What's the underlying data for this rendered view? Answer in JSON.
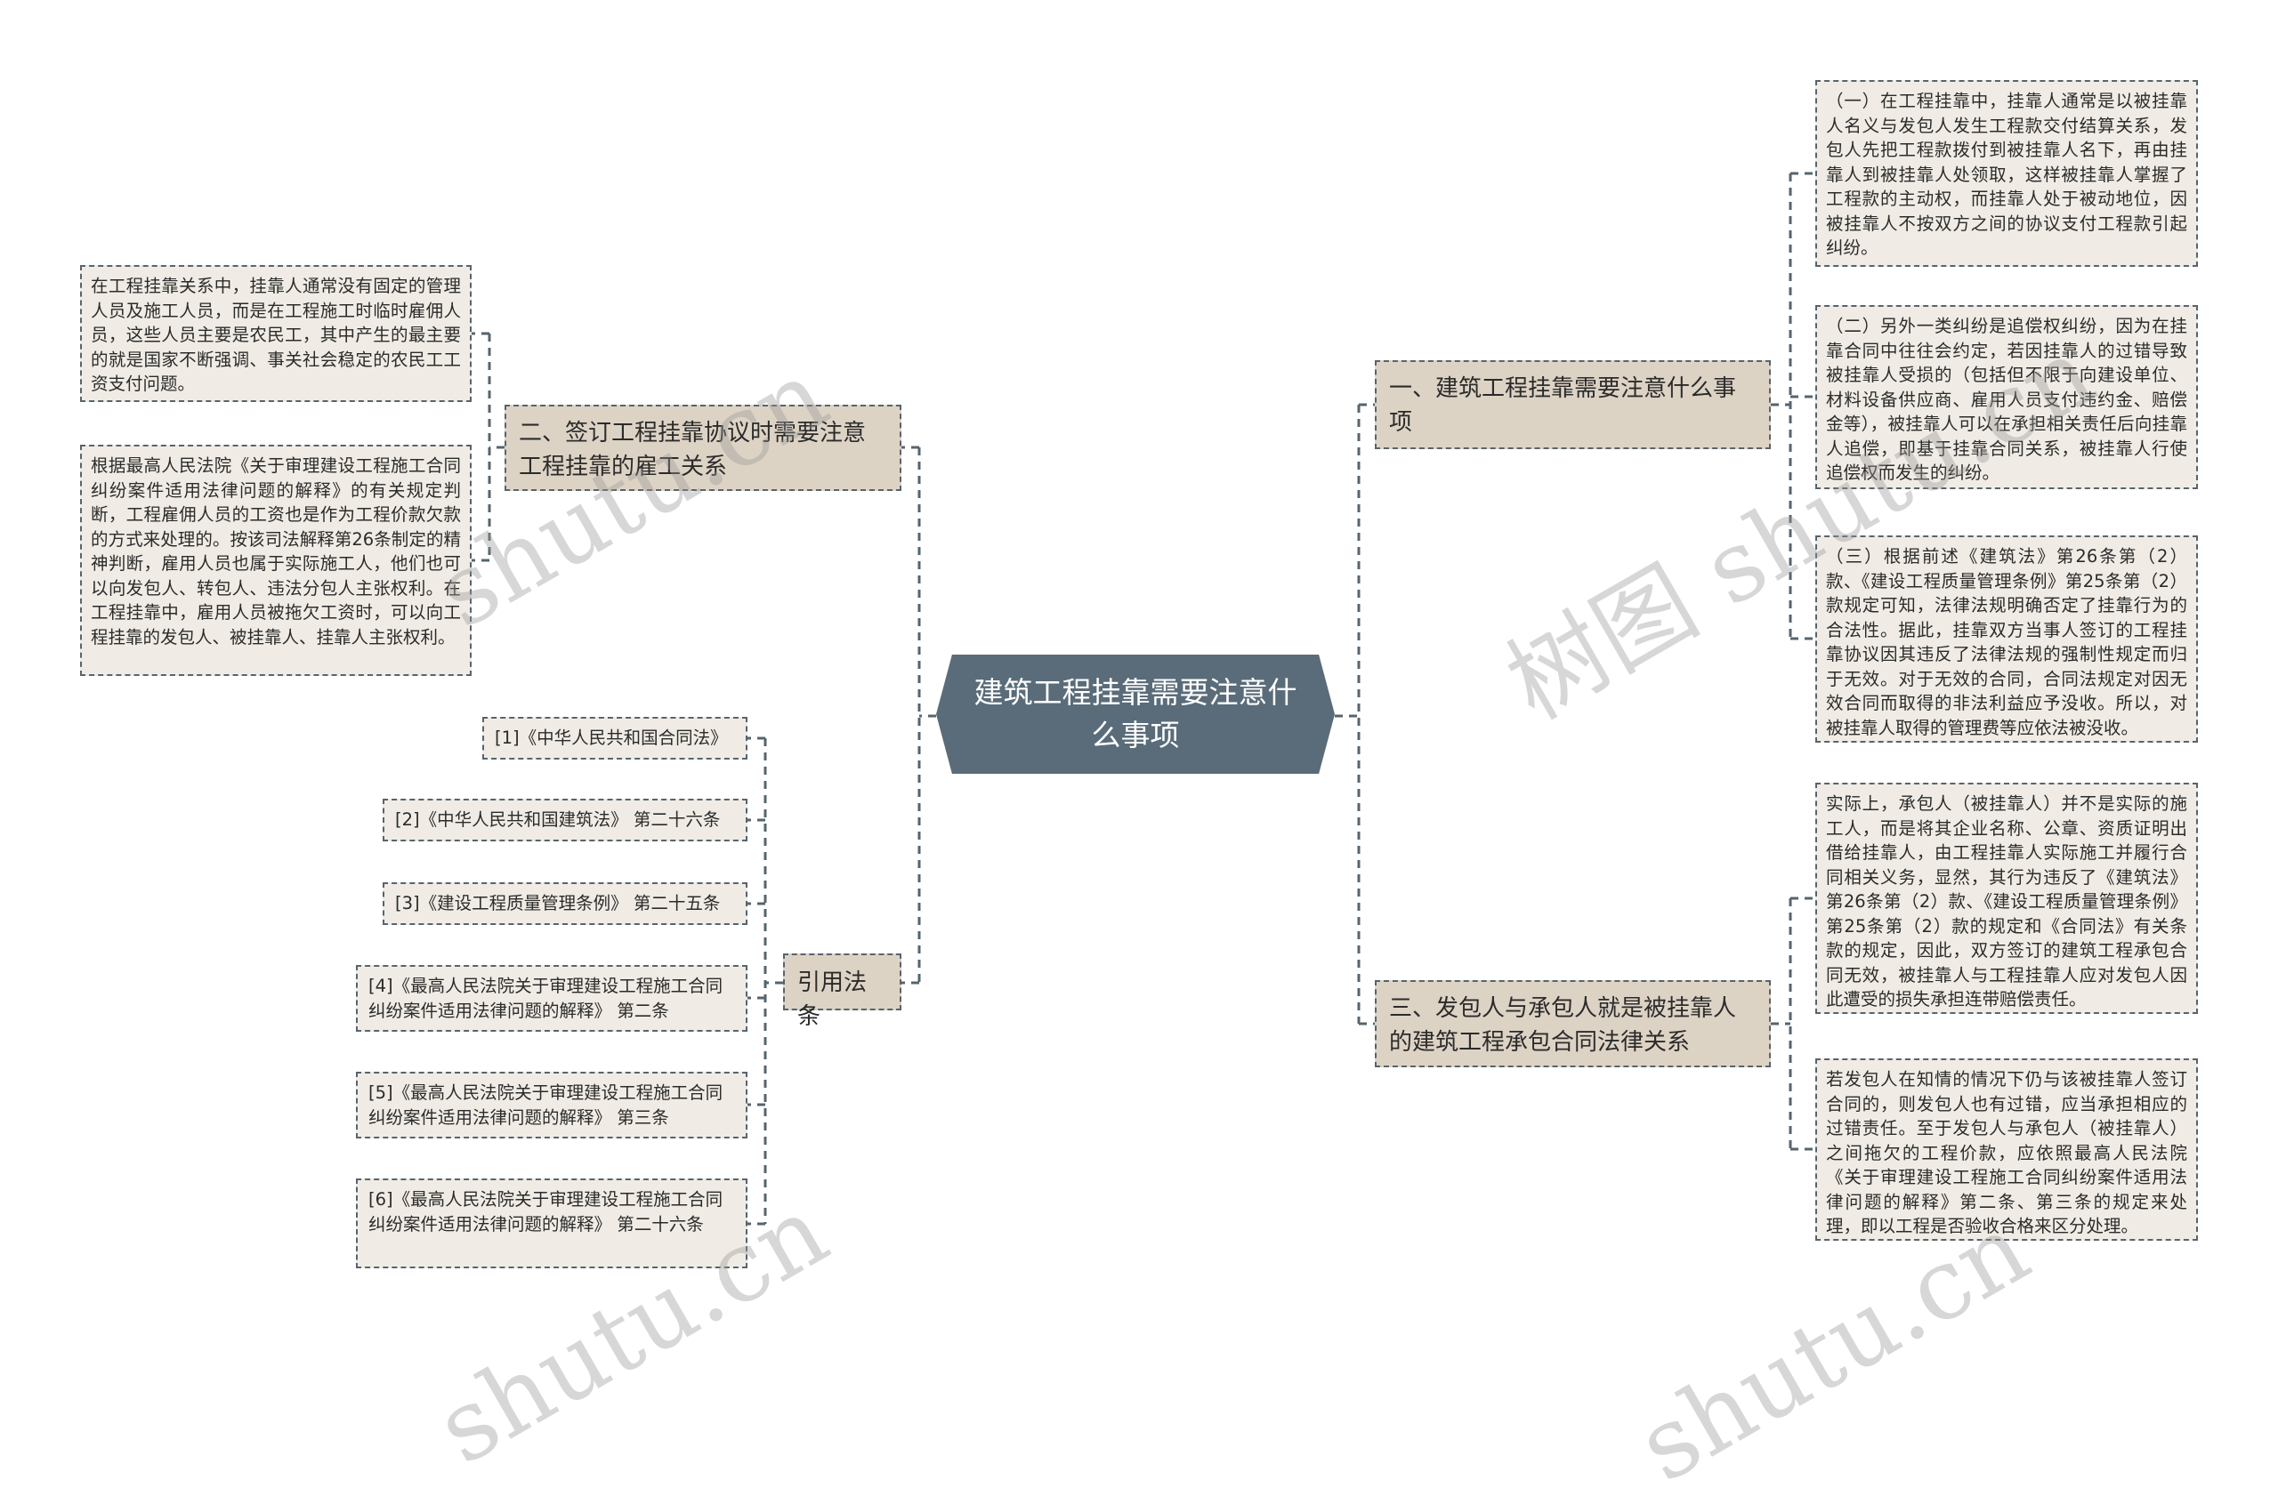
{
  "center": {
    "title": "建筑工程挂靠需要注意什么事项"
  },
  "branches": {
    "left_employment": {
      "title": "二、签订工程挂靠协议时需要注意工程挂靠的雇工关系",
      "details": [
        "在工程挂靠关系中，挂靠人通常没有固定的管理人员及施工人员，而是在工程施工时临时雇佣人员，这些人员主要是农民工，其中产生的最主要的就是国家不断强调、事关社会稳定的农民工工资支付问题。",
        "根据最高人民法院《关于审理建设工程施工合同纠纷案件适用法律问题的解释》的有关规定判断，工程雇佣人员的工资也是作为工程价款欠款的方式来处理的。按该司法解释第26条制定的精神判断，雇用人员也属于实际施工人，他们也可以向发包人、转包人、违法分包人主张权利。在工程挂靠中，雇用人员被拖欠工资时，可以向工程挂靠的发包人、被挂靠人、挂靠人主张权利。"
      ]
    },
    "left_refs": {
      "title": "引用法条",
      "items": [
        "[1]《中华人民共和国合同法》",
        "[2]《中华人民共和国建筑法》 第二十六条",
        "[3]《建设工程质量管理条例》 第二十五条",
        "[4]《最高人民法院关于审理建设工程施工合同纠纷案件适用法律问题的解释》 第二条",
        "[5]《最高人民法院关于审理建设工程施工合同纠纷案件适用法律问题的解释》 第三条",
        "[6]《最高人民法院关于审理建设工程施工合同纠纷案件适用法律问题的解释》 第二十六条"
      ]
    },
    "right_notes": {
      "title": "一、建筑工程挂靠需要注意什么事项",
      "details": [
        "（一）在工程挂靠中，挂靠人通常是以被挂靠人名义与发包人发生工程款交付结算关系，发包人先把工程款拨付到被挂靠人名下，再由挂靠人到被挂靠人处领取，这样被挂靠人掌握了工程款的主动权，而挂靠人处于被动地位，因被挂靠人不按双方之间的协议支付工程款引起纠纷。",
        "（二）另外一类纠纷是追偿权纠纷，因为在挂靠合同中往往会约定，若因挂靠人的过错导致被挂靠人受损的（包括但不限于向建设单位、材料设备供应商、雇用人员支付违约金、赔偿金等），被挂靠人可以在承担相关责任后向挂靠人追偿，即基于挂靠合同关系，被挂靠人行使追偿权而发生的纠纷。",
        "（三）根据前述《建筑法》第26条第（2）款、《建设工程质量管理条例》第25条第（2）款规定可知，法律法规明确否定了挂靠行为的合法性。据此，挂靠双方当事人签订的工程挂靠协议因其违反了法律法规的强制性规定而归于无效。对于无效的合同，合同法规定对因无效合同而取得的非法利益应予没收。所以，对被挂靠人取得的管理费等应依法被没收。"
      ]
    },
    "right_contract": {
      "title": "三、发包人与承包人就是被挂靠人的建筑工程承包合同法律关系",
      "details": [
        "实际上，承包人（被挂靠人）并不是实际的施工人，而是将其企业名称、公章、资质证明出借给挂靠人，由工程挂靠人实际施工并履行合同相关义务，显然，其行为违反了《建筑法》第26条第（2）款、《建设工程质量管理条例》第25条第（2）款的规定和《合同法》有关条款的规定，因此，双方签订的建筑工程承包合同无效，被挂靠人与工程挂靠人应对发包人因此遭受的损失承担连带赔偿责任。",
        "若发包人在知情的情况下仍与该被挂靠人签订合同的，则发包人也有过错，应当承担相应的过错责任。至于发包人与承包人（被挂靠人）之间拖欠的工程价款，应依照最高人民法院《关于审理建设工程施工合同纠纷案件适用法律问题的解释》第二条、第三条的规定来处理，即以工程是否验收合格来区分处理。"
      ]
    }
  },
  "watermarks": [
    "shutu.cn",
    "树图 shutu.cn",
    "shutu.cn",
    "shutu.cn"
  ],
  "colors": {
    "center_fill": "#5a6c79",
    "topic_fill": "#ddd3c5",
    "detail_fill": "#f0ece5",
    "connector": "#56646e"
  }
}
